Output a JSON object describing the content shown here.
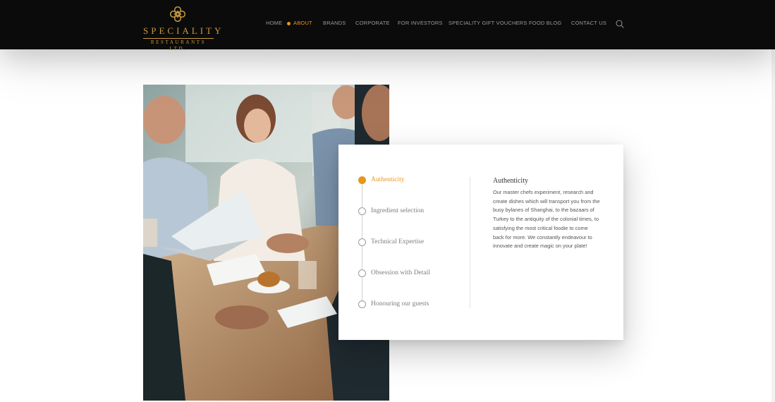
{
  "brand": {
    "name": "SPECIALITY",
    "subtitle": "RESTAURANTS LTD.",
    "accent_color": "#c99a3b"
  },
  "nav": {
    "items": [
      {
        "label": "HOME",
        "active": false
      },
      {
        "label": "ABOUT",
        "active": true
      },
      {
        "label": "BRANDS",
        "active": false
      },
      {
        "label": "CORPORATE",
        "active": false
      },
      {
        "label": "FOR INVESTORS",
        "active": false
      },
      {
        "label": "SPECIALITY GIFT VOUCHERS",
        "active": false
      },
      {
        "label": "FOOD BLOG",
        "active": false
      },
      {
        "label": "CONTACT US",
        "active": false
      }
    ],
    "search_icon": "search-icon",
    "active_color": "#e8961b"
  },
  "photo": {
    "icon": "business-meeting-photo"
  },
  "values": {
    "steps": [
      {
        "label": "Authenticity",
        "active": true
      },
      {
        "label": "Ingredient selection",
        "active": false
      },
      {
        "label": "Technical Expertise",
        "active": false
      },
      {
        "label": "Obsession with Detail",
        "active": false
      },
      {
        "label": "Honouring our guests",
        "active": false
      }
    ],
    "detail": {
      "title": "Authenticity",
      "text": "Our master chefs experiment, research and create dishes which will transport you from the busy bylanes of Shanghai, to the bazaars of Turkey to the antiquity of the colonial times, to satisfying the most critical foodie to come back for more. We constantly endeavour to innovate and create magic on your plate!"
    }
  }
}
